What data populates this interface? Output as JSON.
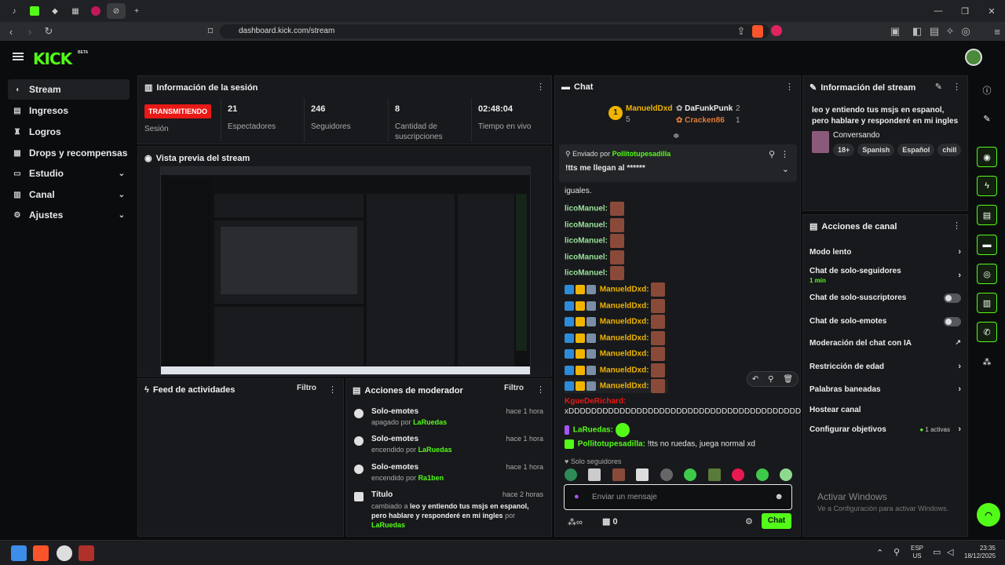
{
  "browser": {
    "tabs": [
      "tiktok",
      "kick",
      "app",
      "app2",
      "21",
      "active"
    ],
    "url": "dashboard.kick.com/stream"
  },
  "sidebar": {
    "items": [
      {
        "label": "Stream",
        "icon": "stream-icon",
        "active": true
      },
      {
        "label": "Ingresos",
        "icon": "income-icon"
      },
      {
        "label": "Logros",
        "icon": "trophy-icon"
      },
      {
        "label": "Drops y recompensas",
        "icon": "gift-icon"
      },
      {
        "label": "Estudio",
        "icon": "studio-icon",
        "expandable": true
      },
      {
        "label": "Canal",
        "icon": "channel-icon",
        "expandable": true
      },
      {
        "label": "Ajustes",
        "icon": "gear-icon",
        "expandable": true
      }
    ]
  },
  "session": {
    "title": "Información de la sesión",
    "status_badge": "TRANSMITIENDO",
    "status_label": "Sesión",
    "stats": [
      {
        "value": "21",
        "label": "Espectadores"
      },
      {
        "value": "246",
        "label": "Seguidores"
      },
      {
        "value": "8",
        "label": "Cantidad de suscripciones"
      },
      {
        "value": "02:48:04",
        "label": "Tiempo en vivo"
      }
    ]
  },
  "preview": {
    "title": "Vista previa del stream"
  },
  "activity": {
    "title": "Feed de actividades",
    "filter": "Filtro"
  },
  "modactions": {
    "title": "Acciones de moderador",
    "filter": "Filtro",
    "items": [
      {
        "title": "Solo-emotes",
        "sub_prefix": "apagado por",
        "by": "LaRuedas",
        "time": "hace 1 hora"
      },
      {
        "title": "Solo-emotes",
        "sub_prefix": "encendido por",
        "by": "LaRuedas",
        "time": "hace 1 hora"
      },
      {
        "title": "Solo-emotes",
        "sub_prefix": "encendido por",
        "by": "Ra1ben",
        "time": "hace 1 hora"
      },
      {
        "title": "Título",
        "sub_prefix": "cambiado a",
        "detail": "leo y entiendo tus msjs en espanol, pero hablare y responderé en mi ingles",
        "by_prefix": "por",
        "by": "LaRuedas",
        "time": "hace 2 horas"
      }
    ]
  },
  "chat": {
    "title": "Chat",
    "leaderboard": [
      {
        "rank": "1",
        "name": "ManueldDxd",
        "count": "5"
      },
      {
        "name": "DaFunkPunk",
        "count": "2"
      },
      {
        "name": "Cracken86",
        "count": "1"
      }
    ],
    "pinned": {
      "prefix": "Enviado por",
      "user": "Pollitotupesadilla",
      "message": "!tts me llegan al ******"
    },
    "messages": [
      {
        "user": "",
        "text": "iguales."
      },
      {
        "user": "licoManuel:"
      },
      {
        "user": "licoManuel:"
      },
      {
        "user": "licoManuel:"
      },
      {
        "user": "licoManuel:"
      },
      {
        "user": "licoManuel:"
      },
      {
        "user": "ManueldDxd:"
      },
      {
        "user": "ManueldDxd:"
      },
      {
        "user": "ManueldDxd:"
      },
      {
        "user": "ManueldDxd:"
      },
      {
        "user": "ManueldDxd:"
      },
      {
        "user": "ManueldDxd:"
      },
      {
        "user": "ManueldDxd:"
      },
      {
        "user": "KgueDeRichard:",
        "text": "xDDDDDDDDDDDDDDDDDDDDDDDDDDDDDDDDDDDDDDDDD"
      },
      {
        "user": "LaRuedas:"
      },
      {
        "user": "Pollitotupesadilla:",
        "text": "!tts no ruedas, juega normal xd"
      }
    ],
    "followers_only": "Solo seguidores",
    "input_placeholder": "Enviar un mensaje",
    "points": "0",
    "send": "Chat"
  },
  "streaminfo": {
    "title": "Información del stream",
    "stream_title": "leo y entiendo tus msjs en espanol, pero hablare y responderé en mi ingles",
    "category": "Conversando",
    "tags": [
      "18+",
      "Spanish",
      "Español",
      "chill"
    ]
  },
  "channelactions": {
    "title": "Acciones de canal",
    "items": [
      {
        "label": "Modo lento",
        "control": "chevron"
      },
      {
        "label": "Chat de solo-seguidores",
        "sub": "1 min",
        "control": "chevron"
      },
      {
        "label": "Chat de solo-suscriptores",
        "control": "toggle"
      },
      {
        "label": "Chat de solo-emotes",
        "control": "toggle"
      },
      {
        "label": "Moderación del chat con IA",
        "control": "external"
      },
      {
        "label": "Restricción de edad",
        "control": "chevron"
      },
      {
        "label": "Palabras baneadas",
        "control": "chevron"
      },
      {
        "label": "Hostear canal",
        "control": "none"
      },
      {
        "label": "Configurar objetivos",
        "sub": "1 activas",
        "control": "chevron"
      }
    ]
  },
  "watermark": {
    "line1": "Activar Windows",
    "line2": "Ve a Configuración para activar Windows."
  },
  "taskbar": {
    "lang1": "ESP",
    "lang2": "US",
    "time": "23:35",
    "date": "18/12/2025"
  },
  "colors": {
    "accent": "#53fc18",
    "live": "#e91916",
    "panel": "#18191c"
  }
}
